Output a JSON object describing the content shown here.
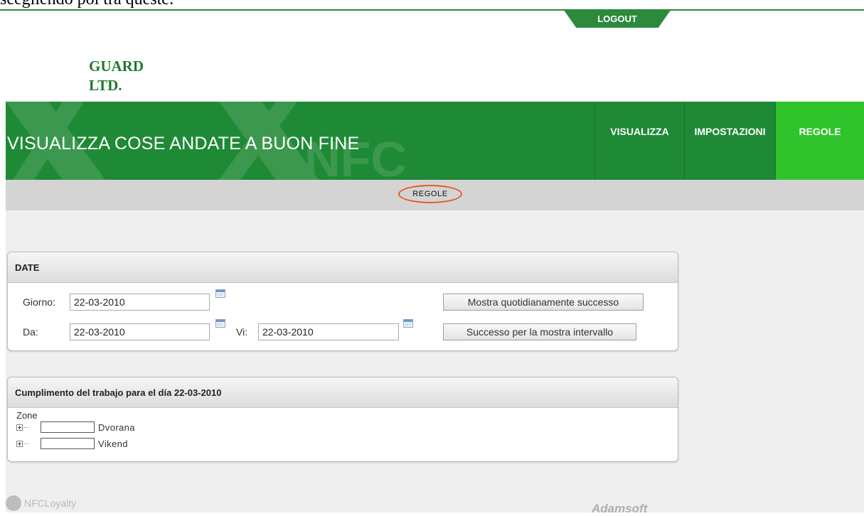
{
  "document_text": "scegliendo poi tra queste:",
  "top": {
    "logout_label": "LOGOUT"
  },
  "company": {
    "line1": "GUARD",
    "line2": "LTD."
  },
  "header": {
    "page_title": "VISUALIZZA COSE ANDATE A BUON FINE",
    "watermark_text": "NFC",
    "nav": [
      {
        "label": "VISUALIZZA"
      },
      {
        "label": "IMPOSTAZIONI"
      },
      {
        "label": "REGOLE",
        "active": true
      }
    ],
    "accent_color": "#1f8a35",
    "active_color": "#2fc42c"
  },
  "subnav": {
    "label": "REGOLE",
    "highlight_color": "#e85a1e"
  },
  "date_panel": {
    "title": "DATE",
    "day_label": "Giorno:",
    "day_value": "22-03-2010",
    "from_label": "Da:",
    "from_value": "22-03-2010",
    "to_label": "Vi:",
    "to_value": "22-03-2010",
    "show_daily_button": "Mostra quotidianamente successo",
    "show_interval_button": "Successo per la mostra intervallo",
    "calendar_icon": "calendar-icon"
  },
  "work_panel": {
    "title": "Cumplimento del trabajo para el día 22-03-2010",
    "tree_root": "Zone",
    "items": [
      {
        "label": "Dvorana"
      },
      {
        "label": "Vikend"
      }
    ]
  },
  "footer": {
    "left_brand": "NFCLoyalty",
    "right_brand": "Adamsoft"
  }
}
